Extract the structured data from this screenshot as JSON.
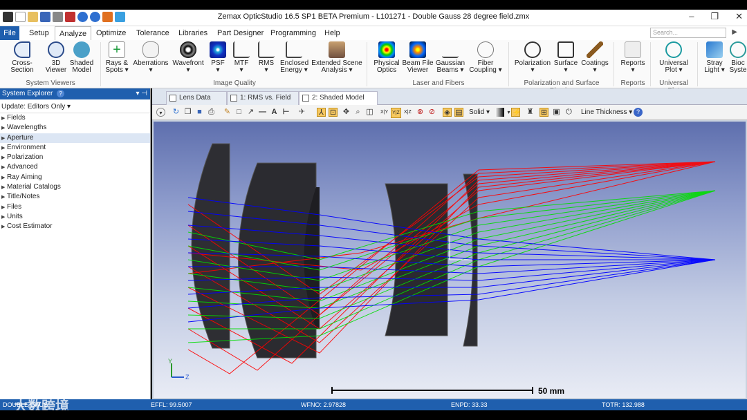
{
  "window": {
    "title": "Zemax OpticStudio 16.5 SP1 BETA  Premium - L101271 - Double Gauss 28 degree field.zmx"
  },
  "menu_tabs": [
    {
      "label": "File"
    },
    {
      "label": "Setup"
    },
    {
      "label": "Analyze"
    },
    {
      "label": "Optimize"
    },
    {
      "label": "Tolerance"
    },
    {
      "label": "Libraries"
    },
    {
      "label": "Part Designer"
    },
    {
      "label": "Programming"
    },
    {
      "label": "Help"
    }
  ],
  "search": {
    "placeholder": "Search..."
  },
  "ribbon": {
    "buttons": [
      {
        "l1": "Cross-Section",
        "l2": ""
      },
      {
        "l1": "3D",
        "l2": "Viewer"
      },
      {
        "l1": "Shaded",
        "l2": "Model"
      },
      {
        "l1": "Rays &",
        "l2": "Spots ▾"
      },
      {
        "l1": "Aberrations",
        "l2": "▾"
      },
      {
        "l1": "Wavefront",
        "l2": "▾"
      },
      {
        "l1": "PSF",
        "l2": "▾"
      },
      {
        "l1": "MTF",
        "l2": "▾"
      },
      {
        "l1": "RMS",
        "l2": "▾"
      },
      {
        "l1": "Enclosed",
        "l2": "Energy ▾"
      },
      {
        "l1": "Extended Scene",
        "l2": "Analysis ▾"
      },
      {
        "l1": "Physical",
        "l2": "Optics"
      },
      {
        "l1": "Beam File",
        "l2": "Viewer"
      },
      {
        "l1": "Gaussian",
        "l2": "Beams ▾"
      },
      {
        "l1": "Fiber",
        "l2": "Coupling ▾"
      },
      {
        "l1": "Polarization",
        "l2": "▾"
      },
      {
        "l1": "Surface",
        "l2": "▾"
      },
      {
        "l1": "Coatings",
        "l2": "▾"
      },
      {
        "l1": "Reports",
        "l2": "▾"
      },
      {
        "l1": "Universal",
        "l2": "Plot ▾"
      },
      {
        "l1": "Stray",
        "l2": "Light ▾"
      },
      {
        "l1": "Bioc",
        "l2": "Syste"
      }
    ],
    "groups": {
      "system_viewers": "System Viewers",
      "image_quality": "Image Quality",
      "laser_fibers": "Laser and Fibers",
      "polarization": "Polarization and Surface Physics",
      "reports": "Reports",
      "universal_plot": "Universal Plot"
    }
  },
  "system_explorer": {
    "title": "System Explorer",
    "update": "Update: Editors Only ▾",
    "items": [
      {
        "label": "Fields"
      },
      {
        "label": "Wavelengths"
      },
      {
        "label": "Aperture"
      },
      {
        "label": "Environment"
      },
      {
        "label": "Polarization"
      },
      {
        "label": "Advanced"
      },
      {
        "label": "Ray Aiming"
      },
      {
        "label": "Material Catalogs"
      },
      {
        "label": "Title/Notes"
      },
      {
        "label": "Files"
      },
      {
        "label": "Units"
      },
      {
        "label": "Cost Estimator"
      }
    ]
  },
  "doc_tabs": [
    {
      "label": "Lens Data"
    },
    {
      "label": "1: RMS vs. Field"
    },
    {
      "label": "2: Shaded Model"
    }
  ],
  "toolbar": {
    "solid": "Solid ▾",
    "line_thickness": "Line Thickness ▾",
    "axis_xy": "X|Y",
    "axis_yz": "Y|Z",
    "axis_xz": "X|Z"
  },
  "viewport": {
    "scale_label": "50 mm",
    "axis_y": "Y",
    "axis_z": "Z"
  },
  "status": {
    "left": "DOUBLE GAUS",
    "effl": "EFFL: 99.5007",
    "wfno": "WFNO: 2.97828",
    "enpd": "ENPD: 33.33",
    "totr": "TOTR: 132.988"
  },
  "watermark": "大数跨境",
  "colors": {
    "ray_red": "#ff0000",
    "ray_green": "#00e000",
    "ray_blue": "#0000ff",
    "accent": "#1f5fae"
  }
}
